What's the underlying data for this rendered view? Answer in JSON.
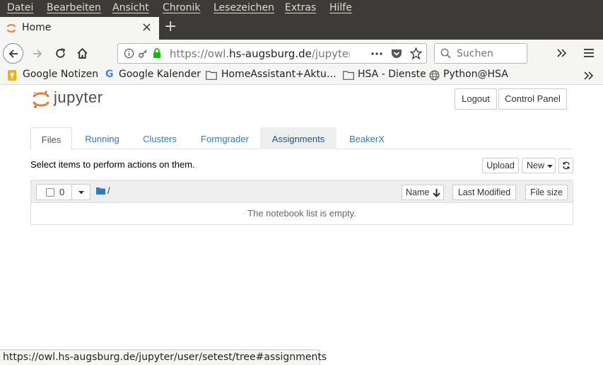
{
  "menubar": {
    "items": [
      "Datei",
      "Bearbeiten",
      "Ansicht",
      "Chronik",
      "Lesezeichen",
      "Extras",
      "Hilfe"
    ]
  },
  "tabs": {
    "active_title": "Home",
    "close_icon": "×",
    "new_tab_icon": "+"
  },
  "navbar": {
    "url_prefix": "https://owl.",
    "url_domain": "hs-augsburg.de",
    "url_path": "/jupyter/u",
    "search_placeholder": "Suchen"
  },
  "bookmarks": {
    "items": [
      "Google Notizen",
      "Google Kalender",
      "HomeAssistant+Aktu…",
      "HSA - Dienste",
      "Python@HSA"
    ]
  },
  "jupyter": {
    "logo_text": "jupyter",
    "logout_label": "Logout",
    "control_panel_label": "Control Panel",
    "tabs": [
      "Files",
      "Running",
      "Clusters",
      "Formgrader",
      "Assignments",
      "BeakerX"
    ],
    "instruction": "Select items to perform actions on them.",
    "upload_label": "Upload",
    "new_label": "New",
    "selected_count": "0",
    "breadcrumb_root": "/",
    "col_name": "Name",
    "col_last_modified": "Last Modified",
    "col_file_size": "File size",
    "empty_message": "The notebook list is empty."
  },
  "statusbar": {
    "link_url": "https://owl.hs-augsburg.de/jupyter/user/setest/tree#assignments"
  },
  "colors": {
    "menubar_bg": "#3c3b37",
    "toolbar_bg": "#f5f5f4",
    "link_blue": "#337ab7",
    "jupyter_orange": "#f37726"
  }
}
